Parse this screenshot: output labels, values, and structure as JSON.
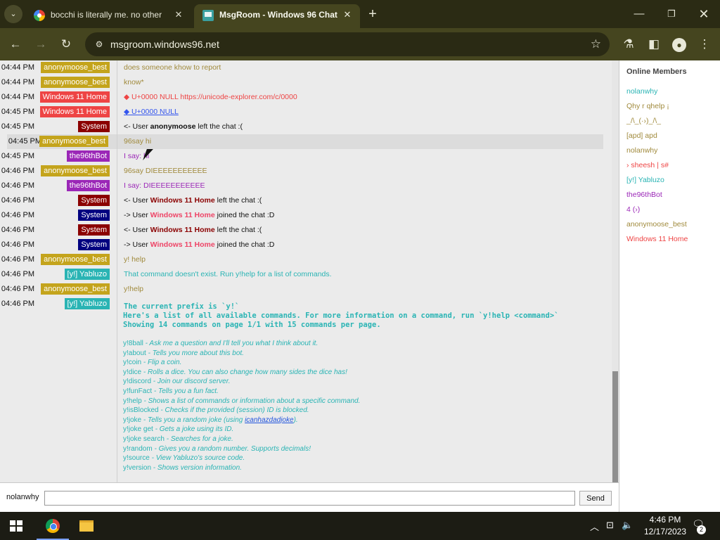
{
  "browser": {
    "tabs": [
      {
        "title": "bocchi is literally me. no other",
        "close": "✕"
      },
      {
        "title": "MsgRoom - Windows 96 Chat",
        "close": "✕"
      }
    ],
    "new_tab": "+",
    "window_controls": {
      "minimize": "—",
      "maximize": "❐",
      "close": "✕"
    },
    "nav": {
      "back": "←",
      "forward": "→",
      "reload": "↻"
    },
    "url": "msgroom.windows96.net",
    "icons": [
      "site-info-icon",
      "star-icon",
      "labs-icon",
      "side-panel-icon",
      "profile-icon",
      "menu-icon"
    ]
  },
  "chat": {
    "messages": [
      {
        "time": "04:44 PM",
        "user": "anonymoose_best",
        "color": "#c4a41c",
        "text": "does someone khow to report",
        "text_color": "#a08a3c"
      },
      {
        "time": "04:44 PM",
        "user": "anonymoose_best",
        "color": "#c4a41c",
        "text": "know*",
        "text_color": "#a08a3c"
      },
      {
        "time": "04:44 PM",
        "user": "Windows 11 Home",
        "color": "#ee4444",
        "text": "◆ U+0000 NULL https://unicode-explorer.com/c/0000",
        "text_color": "#ee4444"
      },
      {
        "time": "04:45 PM",
        "user": "Windows 11 Home",
        "color": "#ee4444",
        "text": "◆ U+0000 NULL",
        "text_color": "#3355ee"
      },
      {
        "time": "04:45 PM",
        "user": "System",
        "color": "#8b0000",
        "pre": "<- User ",
        "name": "anonymoose",
        "post": " left the chat :(",
        "name_color": "#111111"
      },
      {
        "time": "04:45 PM",
        "user": "anonymoose_best",
        "color": "#c4a41c",
        "text": "96say hi",
        "text_color": "#a08a3c",
        "highlight": true
      },
      {
        "time": "04:45 PM",
        "user": "the96thBot",
        "color": "#9b27b7",
        "text": "I say: hi",
        "text_color": "#9b27b7"
      },
      {
        "time": "04:46 PM",
        "user": "anonymoose_best",
        "color": "#c4a41c",
        "text": "96say DIEEEEEEEEEEE",
        "text_color": "#a08a3c"
      },
      {
        "time": "04:46 PM",
        "user": "the96thBot",
        "color": "#9b27b7",
        "text": "I say: DIEEEEEEEEEEE",
        "text_color": "#9b27b7"
      },
      {
        "time": "04:46 PM",
        "user": "System",
        "color": "#8b0000",
        "pre": "<- User ",
        "name": "Windows 11 Home",
        "post": " left the chat :(",
        "name_color": "#8b0000"
      },
      {
        "time": "04:46 PM",
        "user": "System",
        "color": "#000080",
        "pre": "-> User ",
        "name": "Windows 11 Home",
        "post": " joined the chat :D",
        "name_color": "#ee4466"
      },
      {
        "time": "04:46 PM",
        "user": "System",
        "color": "#8b0000",
        "pre": "<- User ",
        "name": "Windows 11 Home",
        "post": " left the chat :(",
        "name_color": "#8b0000"
      },
      {
        "time": "04:46 PM",
        "user": "System",
        "color": "#000080",
        "pre": "-> User ",
        "name": "Windows 11 Home",
        "post": " joined the chat :D",
        "name_color": "#ee4466"
      },
      {
        "time": "04:46 PM",
        "user": "anonymoose_best",
        "color": "#c4a41c",
        "text": "y! help",
        "text_color": "#a08a3c"
      },
      {
        "time": "04:46 PM",
        "user": "[y!] Yabluzo",
        "color": "#2ab4b4",
        "text": "That command doesn't exist. Run y!help for a list of commands.",
        "text_color": "#2ab4b4"
      },
      {
        "time": "04:46 PM",
        "user": "anonymoose_best",
        "color": "#c4a41c",
        "text": "y!help",
        "text_color": "#a08a3c"
      },
      {
        "time": "04:46 PM",
        "user": "[y!] Yabluzo",
        "color": "#2ab4b4",
        "text": "",
        "text_color": "#2ab4b4"
      }
    ],
    "help": {
      "header": [
        "The current prefix is `y!`",
        "Here's a list of all available commands. For more information on a command, run `y!help <command>`",
        "Showing 14 commands on page 1/1 with 15 commands per page."
      ],
      "commands": [
        {
          "cmd": "y!8ball",
          "desc": "Ask me a question and I'll tell you what I think about it."
        },
        {
          "cmd": "y!about",
          "desc": "Tells you more about this bot."
        },
        {
          "cmd": "y!coin",
          "desc": "Flip a coin."
        },
        {
          "cmd": "y!dice",
          "desc": "Rolls a dice. You can also change how many sides the dice has!"
        },
        {
          "cmd": "y!discord",
          "desc": "Join our discord server."
        },
        {
          "cmd": "y!funFact",
          "desc": "Tells you a fun fact."
        },
        {
          "cmd": "y!help",
          "desc": "Shows a list of commands or information about a specific command."
        },
        {
          "cmd": "y!isBlocked",
          "desc": "Checks if the provided (session) ID is blocked."
        },
        {
          "cmd": "y!joke",
          "desc": "Tells you a random joke (using ",
          "link": "icanhazdadjoke",
          "after": ")."
        },
        {
          "cmd": "y!joke get",
          "desc": "Gets a joke using its ID."
        },
        {
          "cmd": "y!joke search",
          "desc": "Searches for a joke."
        },
        {
          "cmd": "y!random",
          "desc": "Gives you a random number. Supports decimals!"
        },
        {
          "cmd": "y!source",
          "desc": "View Yabluzo's source code."
        },
        {
          "cmd": "y!version",
          "desc": "Shows version information."
        }
      ]
    }
  },
  "members": {
    "title": "Online Members",
    "list": [
      {
        "name": "nolanwhy",
        "color": "#2ab4b4"
      },
      {
        "name": "Qhy r qhelp ¡",
        "color": "#a08a3c"
      },
      {
        "name": "_/\\_(·›)_/\\_",
        "color": "#a08a3c"
      },
      {
        "name": "[apd] apd",
        "color": "#a08a3c"
      },
      {
        "name": "nolanwhy",
        "color": "#a08a3c"
      },
      {
        "name": "› sheesh | s#",
        "color": "#ee4444"
      },
      {
        "name": "[y!] Yabluzo",
        "color": "#2ab4b4"
      },
      {
        "name": "the96thBot",
        "color": "#9b27b7"
      },
      {
        "name": "4 (›)",
        "color": "#9b27b7"
      },
      {
        "name": "anonymoose_best",
        "color": "#a08a3c"
      },
      {
        "name": "Windows 11 Home",
        "color": "#ee4444"
      }
    ]
  },
  "composer": {
    "nick": "nolanwhy",
    "value": "",
    "send": "Send"
  },
  "taskbar": {
    "time": "4:46 PM",
    "date": "12/17/2023",
    "notifications": "2",
    "icons": [
      "start-icon",
      "chrome-icon",
      "file-explorer-icon",
      "tray-chevron-icon",
      "network-icon",
      "volume-icon",
      "notification-icon"
    ]
  }
}
